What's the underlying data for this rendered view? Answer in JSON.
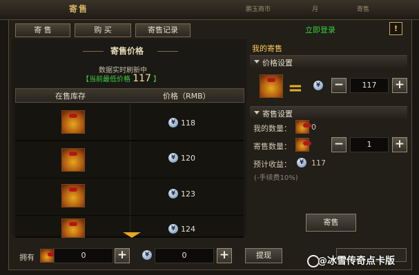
{
  "window": {
    "title_tab": "寄售"
  },
  "top_bar": {
    "partial_labels": [
      "鹏玉商市",
      "月",
      "寄售"
    ]
  },
  "tabs": [
    {
      "label": "寄 售"
    },
    {
      "label": "购 买"
    },
    {
      "label": "寄售记录"
    }
  ],
  "login_link": "立即登录",
  "help_label": "!",
  "left": {
    "section_title": "寄售价格",
    "realtime_note": "数据实时刷新中",
    "lowest_prefix": "【当前最低价格",
    "lowest_value": "117",
    "lowest_suffix": "】",
    "columns": [
      "在售库存",
      "价格（RMB）"
    ],
    "rows": [
      {
        "price": "118"
      },
      {
        "price": "120"
      },
      {
        "price": "123"
      },
      {
        "price": "124"
      }
    ]
  },
  "right": {
    "title": "我的寄售",
    "price_setting": {
      "header": "价格设置",
      "value": "117",
      "minus": "−",
      "plus": "+"
    },
    "consign_setting": {
      "header": "寄售设置",
      "my_qty_label": "我的数量：",
      "my_qty_value": "0",
      "consign_qty_label": "寄售数量：",
      "consign_qty_value": "1",
      "minus": "−",
      "plus": "+",
      "expected_label": "预计收益：",
      "expected_value": "117",
      "fee_note": "(-手续费10%)"
    },
    "consign_button": "寄售"
  },
  "bottom": {
    "have_label": "拥有",
    "bag_value": "0",
    "coin_value": "0",
    "plus": "+",
    "withdraw_button": "提现"
  },
  "watermark": "@冰雪传奇点卡版",
  "icons": {
    "coin": "rmb-coin-icon",
    "bag": "gold-bag-icon"
  },
  "colors": {
    "accent_green": "#36d03a",
    "accent_gold": "#e8b020"
  }
}
